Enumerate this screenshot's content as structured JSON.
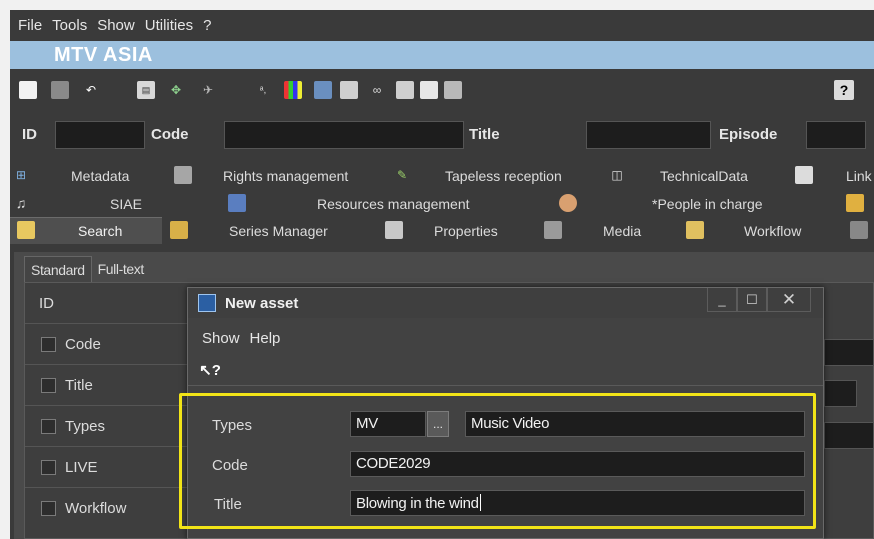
{
  "menu": {
    "items": [
      "File",
      "Tools",
      "Show",
      "Utilities",
      "?"
    ]
  },
  "banner": {
    "title": "MTV ASIA"
  },
  "toolbar": {
    "icons": [
      "new-document-icon",
      "save-icon",
      "undo-icon",
      "copy-icon",
      "network-icon",
      "satellite-icon",
      "text-style-icon",
      "color-bars-icon",
      "film-strip-icon",
      "copy-pages-icon",
      "binoculars-icon",
      "copy-pages-alt-icon",
      "find-document-icon",
      "document-stack-icon"
    ],
    "help_icon": "context-help-icon"
  },
  "fieldbar": {
    "id_label": "ID",
    "id_value": "",
    "code_label": "Code",
    "code_value": "",
    "title_label": "Title",
    "title_value": "",
    "episode_label": "Episode",
    "episode_value": ""
  },
  "tabs": {
    "row1": [
      {
        "label": "Metadata",
        "icon": "metadata-icon"
      },
      {
        "label": "Rights management",
        "icon": "rights-icon"
      },
      {
        "label": "Tapeless reception",
        "icon": "tapeless-icon"
      },
      {
        "label": "TechnicalData",
        "icon": "technical-icon"
      },
      {
        "label": "Link",
        "icon": "link-icon"
      }
    ],
    "row2": [
      {
        "label": "SIAE",
        "icon": "music-note-icon"
      },
      {
        "label": "Resources management",
        "icon": "resources-icon"
      },
      {
        "label": "*People in charge",
        "icon": "people-icon"
      },
      {
        "label": "",
        "icon": "folder-icon"
      }
    ],
    "row3": [
      {
        "label": "Search",
        "icon": "search-icon"
      },
      {
        "label": "Series Manager",
        "icon": "series-icon"
      },
      {
        "label": "Properties",
        "icon": "properties-icon"
      },
      {
        "label": "Media",
        "icon": "media-icon"
      },
      {
        "label": "Workflow",
        "icon": "workflow-icon"
      },
      {
        "label": "",
        "icon": "grid-icon"
      }
    ]
  },
  "search": {
    "subtabs": [
      "Standard",
      "Full-text"
    ],
    "id_label": "ID",
    "rows": [
      "Code",
      "Title",
      "Types",
      "LIVE",
      "Workflow"
    ]
  },
  "dialog": {
    "title": "New asset",
    "menu": [
      "Show",
      "Help"
    ],
    "minimize": "_",
    "maximize": "☐",
    "close": "✕",
    "help_tool": "?",
    "types_label": "Types",
    "types_code": "MV",
    "browse": "...",
    "types_desc": "Music Video",
    "code_label": "Code",
    "code_value": "CODE2029",
    "title_label": "Title",
    "title_value": "Blowing in the wind"
  },
  "colors": {
    "highlight": "#f2e417",
    "banner": "#9cc0de",
    "background": "#3a3a3a"
  }
}
